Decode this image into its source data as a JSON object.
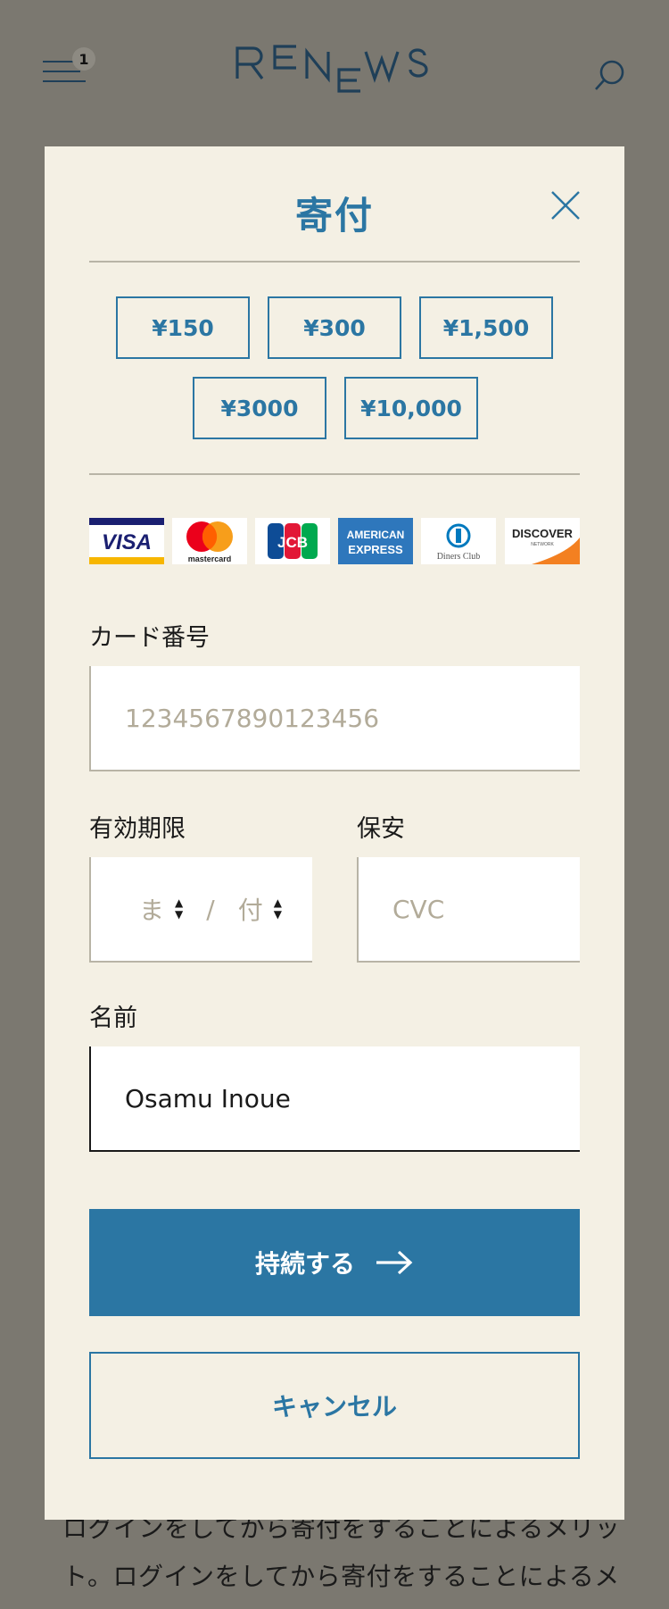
{
  "header": {
    "menu_badge": "1",
    "logo_text": "RENEWS"
  },
  "modal": {
    "title": "寄付",
    "amounts": [
      "¥150",
      "¥300",
      "¥1,500",
      "¥3000",
      "¥10,000"
    ],
    "card_brands": [
      "visa-icon",
      "mastercard-icon",
      "jcb-icon",
      "amex-icon",
      "diners-club-icon",
      "discover-icon"
    ],
    "card_brand_labels": {
      "visa": "VISA",
      "mastercard": "mastercard",
      "jcb": "JCB",
      "amex_1": "AMERICAN",
      "amex_2": "EXPRESS",
      "diners": "Diners Club",
      "discover": "DISCOVER",
      "discover_sub": "NETWORK"
    },
    "card_number": {
      "label": "カード番号",
      "placeholder": "1234567890123456"
    },
    "expiry": {
      "label": "有効期限",
      "month_placeholder": "ま",
      "separator": "/",
      "year_placeholder": "付"
    },
    "cvc": {
      "label": "保安",
      "placeholder": "CVC"
    },
    "name": {
      "label": "名前",
      "value": "Osamu Inoue"
    },
    "continue_label": "持続する",
    "cancel_label": "キャンセル"
  },
  "background_text": {
    "line1": "ログインをしてから寄付をすることによるメリッ",
    "line2": "ト。ログインをしてから寄付をすることによるメ"
  },
  "colors": {
    "accent": "#2b76a3",
    "modal_bg": "#f4f0e4",
    "overlay_bg": "#7b7870"
  }
}
